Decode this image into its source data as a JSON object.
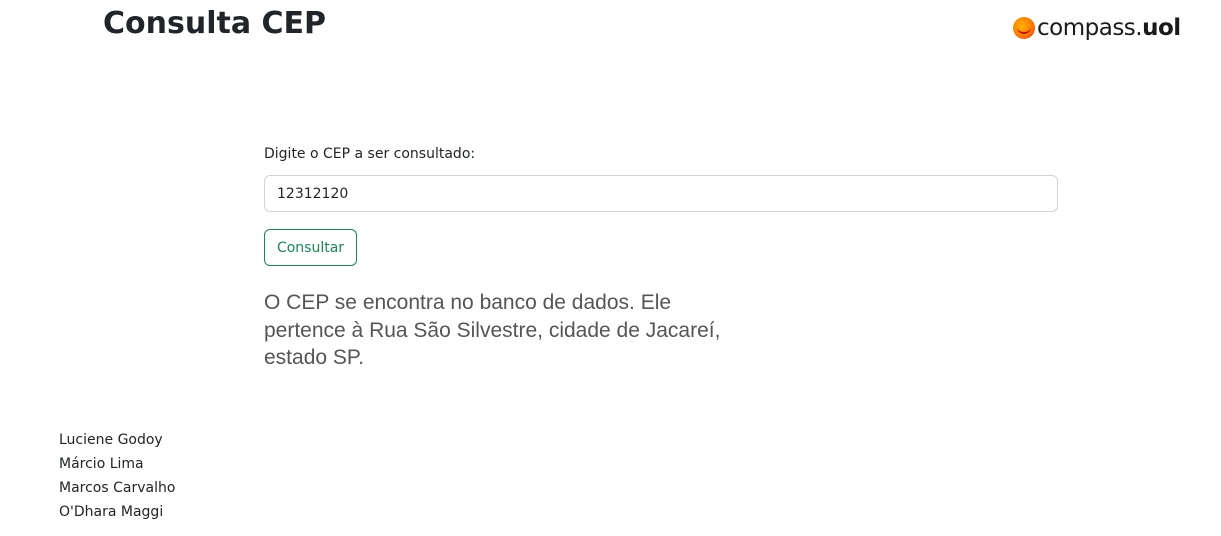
{
  "header": {
    "title": "Consulta CEP",
    "logo": {
      "text_regular": "compass.",
      "text_bold": "uol",
      "icon": "compass-uol-logo-icon",
      "colors": {
        "mark_orange": "#ff7a00",
        "mark_red": "#e8192c",
        "text": "#1a1a1a"
      }
    }
  },
  "form": {
    "label": "Digite o CEP a ser consultado:",
    "input_value": "12312120",
    "button_label": "Consultar",
    "button_color": "#198754"
  },
  "result": {
    "message": "O CEP se encontra no banco de dados. Ele pertence à Rua São Silvestre, cidade de Jacareí, estado SP."
  },
  "footer": {
    "authors": [
      "Luciene Godoy",
      "Márcio Lima",
      "Marcos Carvalho",
      "O'Dhara Maggi"
    ]
  }
}
